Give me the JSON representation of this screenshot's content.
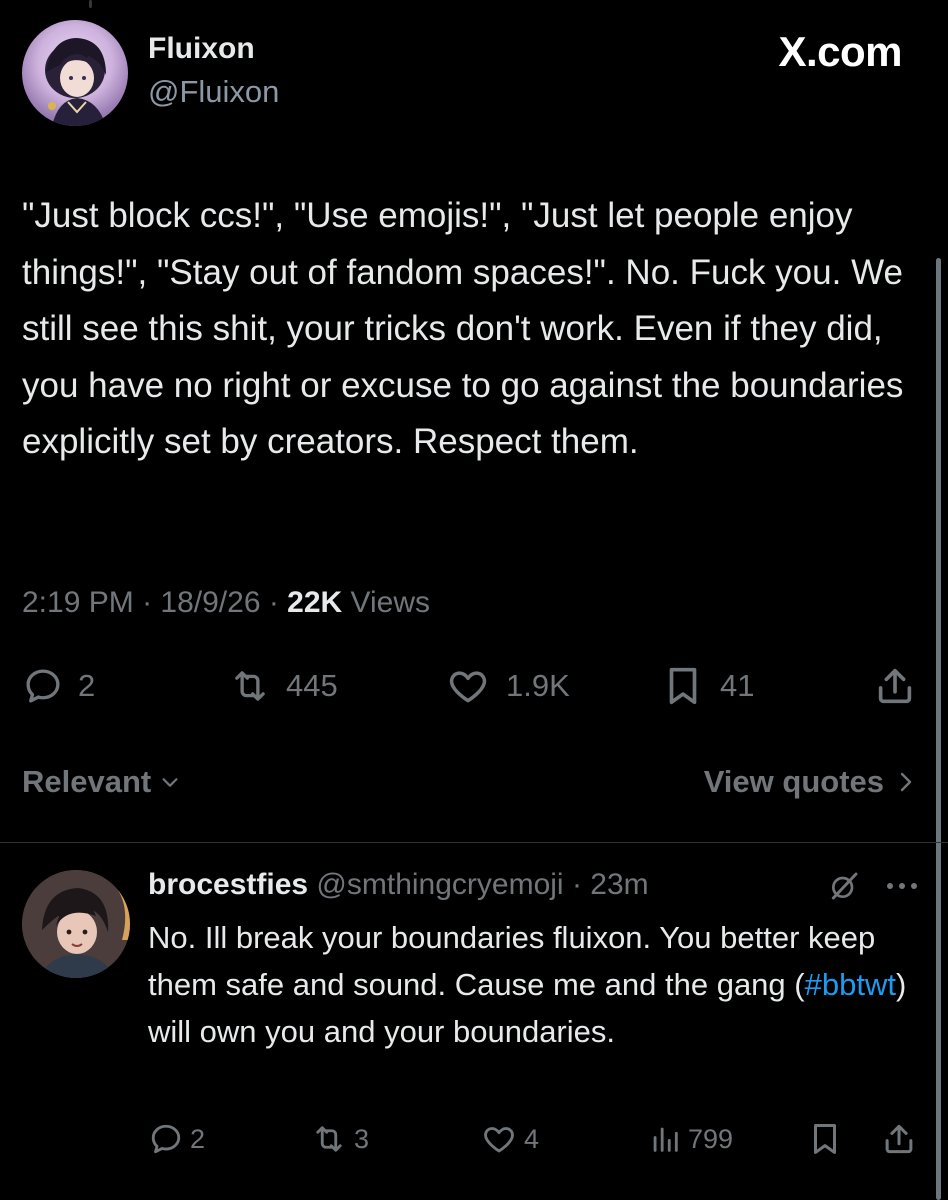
{
  "brand": {
    "logo_text": "X.com",
    "accent": "#1d9bf0"
  },
  "post": {
    "display_name": "Fluixon",
    "handle": "@Fluixon",
    "text": "\"Just block ccs!\", \"Use emojis!\", \"Just let people enjoy things!\", \"Stay out of fandom spaces!\". No. Fuck you. We still see this shit, your tricks don't work. Even if they did, you have no right or excuse to go against the boundaries explicitly set by creators. Respect them.",
    "time": "2:19 PM",
    "sep1": " · ",
    "date": "18/9/26",
    "sep2": " · ",
    "views_count": "22K",
    "views_label": " Views",
    "actions": {
      "replies": "2",
      "reposts": "445",
      "likes": "1.9K",
      "bookmarks": "41"
    },
    "icons": [
      "reply-icon",
      "repost-icon",
      "like-icon",
      "bookmark-icon",
      "share-icon"
    ]
  },
  "replies_bar": {
    "sort_label": "Relevant",
    "view_quotes_label": "View quotes"
  },
  "reply": {
    "display_name": "brocestfies",
    "handle": "@smthingcryemoji",
    "sep": " · ",
    "time": "23m",
    "text_before": "No. Ill break your boundaries fluixon. You better keep them safe and sound. Cause me and the gang (",
    "hashtag": "#bbtwt",
    "text_after": ") will own you and your boundaries.",
    "actions": {
      "replies": "2",
      "reposts": "3",
      "likes": "4",
      "views": "799"
    },
    "icons": [
      "grok-icon",
      "more-icon",
      "reply-icon",
      "repost-icon",
      "like-icon",
      "views-icon",
      "bookmark-icon",
      "share-icon"
    ]
  }
}
